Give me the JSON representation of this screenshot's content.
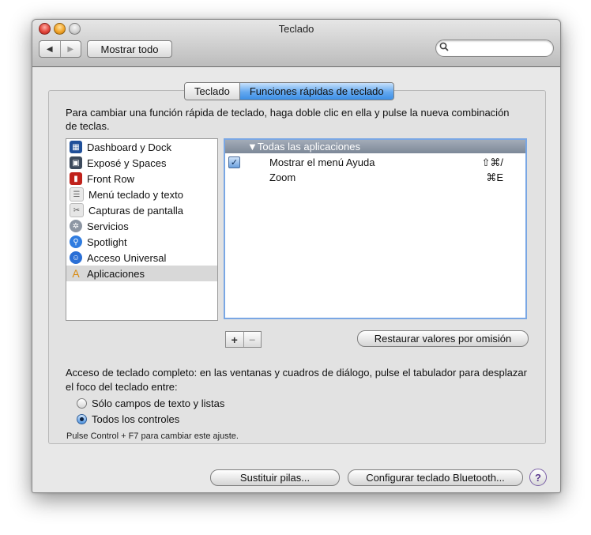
{
  "window": {
    "title": "Teclado"
  },
  "toolbar": {
    "back_icon": "◀",
    "forward_icon": "▶",
    "show_all_label": "Mostrar todo",
    "search_icon": "magnifier",
    "search_value": ""
  },
  "tabs": [
    {
      "label": "Teclado",
      "active": false
    },
    {
      "label": "Funciones rápidas de teclado",
      "active": true
    }
  ],
  "instructions": "Para cambiar una función rápida de teclado, haga doble clic en ella y pulse la nueva combinación de teclas.",
  "categories": [
    {
      "label": "Dashboard y Dock",
      "icon": "dashboard-icon",
      "selected": false
    },
    {
      "label": "Exposé y Spaces",
      "icon": "expose-icon",
      "selected": false
    },
    {
      "label": "Front Row",
      "icon": "front-row-icon",
      "selected": false
    },
    {
      "label": "Menú teclado y texto",
      "icon": "keyboard-menu-icon",
      "selected": false
    },
    {
      "label": "Capturas de pantalla",
      "icon": "screenshot-icon",
      "selected": false
    },
    {
      "label": "Servicios",
      "icon": "services-gear-icon",
      "selected": false
    },
    {
      "label": "Spotlight",
      "icon": "spotlight-icon",
      "selected": false
    },
    {
      "label": "Acceso Universal",
      "icon": "universal-access-icon",
      "selected": false
    },
    {
      "label": "Aplicaciones",
      "icon": "applications-icon",
      "selected": true
    }
  ],
  "shortcuts": {
    "group_label": "▼Todas las aplicaciones",
    "rows": [
      {
        "name": "Mostrar el menú Ayuda",
        "keys": "⇧⌘/",
        "checked": true
      },
      {
        "name": "Zoom",
        "keys": "⌘E",
        "checked": false
      }
    ]
  },
  "controls": {
    "add_label": "+",
    "remove_label": "−",
    "restore_label": "Restaurar valores por omisión"
  },
  "access": {
    "text": "Acceso de teclado completo: en las ventanas y cuadros de diálogo, pulse el tabulador para desplazar el foco del teclado entre:",
    "options": [
      {
        "label": "Sólo campos de texto y listas",
        "selected": false
      },
      {
        "label": "Todos los controles",
        "selected": true
      }
    ],
    "hint": "Pulse Control + F7 para cambiar este ajuste."
  },
  "footer": {
    "replace_batteries_label": "Sustituir pilas...",
    "bluetooth_label": "Configurar teclado Bluetooth...",
    "help_label": "?"
  },
  "colors": {
    "accent": "#3d8fe6",
    "selection": "#d8d8d8",
    "group_header": "#8a94a3"
  }
}
